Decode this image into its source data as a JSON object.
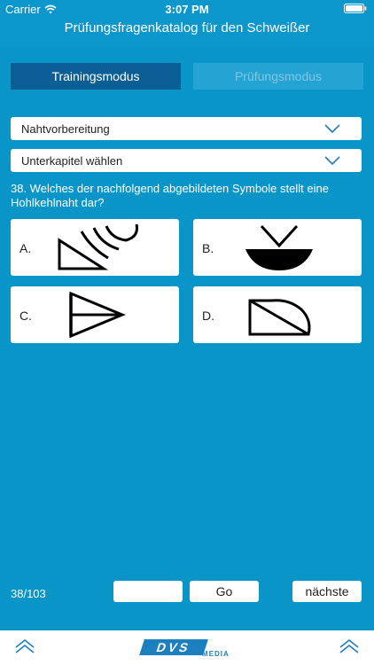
{
  "status": {
    "carrier": "Carrier",
    "time": "3:07 PM"
  },
  "header": {
    "title": "Prüfungsfragenkatalog für den Schweißer"
  },
  "modes": {
    "training": "Trainingsmodus",
    "exam": "Prüfungsmodus"
  },
  "filters": {
    "chapter": "Nahtvorbereitung",
    "subchapter": "Unterkapitel wählen"
  },
  "question": {
    "text": "38. Welches der nachfolgend abgebildeten Symbole stellt eine Hohlkehlnaht dar?"
  },
  "answers": [
    {
      "letter": "A.",
      "symbol": "fillet-weld-with-arcs-symbol"
    },
    {
      "letter": "B.",
      "symbol": "bowl-with-v-symbol"
    },
    {
      "letter": "C.",
      "symbol": "flag-triangle-symbol"
    },
    {
      "letter": "D.",
      "symbol": "rounded-fillet-symbol"
    }
  ],
  "navigation": {
    "counter": "38/103",
    "page_input_value": "",
    "go_label": "Go",
    "next_label": "nächste"
  },
  "footer": {
    "logo_letters": "DVS",
    "logo_media": "MEDIA"
  },
  "colors": {
    "background": "#0a95c8",
    "mode_active": "#0b5f96",
    "mode_inactive": "#24a4d4",
    "logo_blue": "#1c7fc0"
  }
}
